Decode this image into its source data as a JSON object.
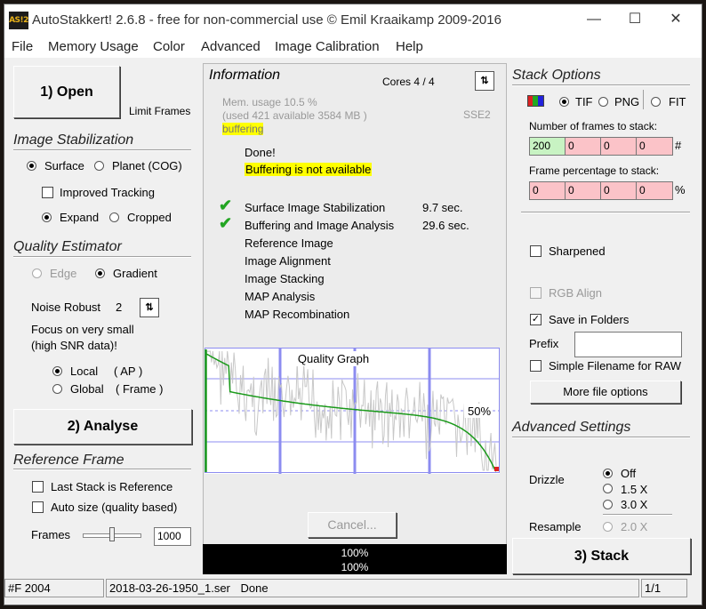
{
  "window": {
    "title": "AutoStakkert! 2.6.8 - free for non-commercial use © Emil Kraaikamp 2009-2016",
    "logo_text": "AS!2",
    "minimize_glyph": "—",
    "maximize_glyph": "☐",
    "close_glyph": "✕"
  },
  "menu": [
    "File",
    "Memory Usage",
    "Color",
    "Advanced",
    "Image Calibration",
    "Help"
  ],
  "left": {
    "open_button": "1) Open",
    "limit_frames": "Limit Frames",
    "stabilization": {
      "title": "Image Stabilization",
      "surface": "Surface",
      "planet": "Planet (COG)",
      "improved_tracking": "Improved Tracking",
      "expand": "Expand",
      "cropped": "Cropped"
    },
    "quality": {
      "title": "Quality Estimator",
      "edge": "Edge",
      "gradient": "Gradient",
      "noise_robust_label": "Noise Robust",
      "noise_robust_value": "2",
      "focus_line1": "Focus on very small",
      "focus_line2": "(high SNR data)!",
      "local": "Local",
      "local_ap": "( AP )",
      "global": "Global",
      "global_frame": "( Frame )"
    },
    "analyse_button": "2) Analyse",
    "reference": {
      "title": "Reference Frame",
      "last_stack": "Last Stack is Reference",
      "auto_size": "Auto size (quality based)",
      "frames_label": "Frames",
      "frames_value": "1000"
    }
  },
  "info": {
    "title": "Information",
    "cores": "Cores 4 / 4",
    "mem_usage": "Mem. usage 10.5 %",
    "mem_detail": "(used 421 available 3584 MB )",
    "buffering": "buffering",
    "sse": "SSE2",
    "done": "Done!",
    "buffer_warning": "Buffering is not available",
    "steps": [
      {
        "label": "Surface Image Stabilization",
        "time": "9.7 sec.",
        "done": true
      },
      {
        "label": "Buffering and Image Analysis",
        "time": "29.6 sec.",
        "done": true
      },
      {
        "label": "Reference Image",
        "time": "",
        "done": false
      },
      {
        "label": "Image Alignment",
        "time": "",
        "done": false
      },
      {
        "label": "Image Stacking",
        "time": "",
        "done": false
      },
      {
        "label": "MAP Analysis",
        "time": "",
        "done": false
      },
      {
        "label": "MAP Recombination",
        "time": "",
        "done": false
      }
    ],
    "check_glyph": "✔",
    "graph_title": "Quality Graph",
    "graph_percent": "50%",
    "cancel_button": "Cancel...",
    "progress_line1": "100%",
    "progress_line2": "100%",
    "progress": 1.0
  },
  "stack": {
    "title": "Stack Options",
    "tif": "TIF",
    "png": "PNG",
    "fit": "FIT",
    "frames_label": "Number of frames to stack:",
    "frames_values": [
      "200",
      "0",
      "0",
      "0"
    ],
    "frames_suffix": "#",
    "percent_label": "Frame percentage to stack:",
    "percent_values": [
      "0",
      "0",
      "0",
      "0"
    ],
    "percent_suffix": "%",
    "sharpened": "Sharpened",
    "rgb_align": "RGB Align",
    "save_in_folders": "Save in Folders",
    "prefix_label": "Prefix",
    "prefix_value": "",
    "simple_filename": "Simple Filename for RAW",
    "more_options": "More file options",
    "checked_glyph": "✓"
  },
  "advanced": {
    "title": "Advanced Settings",
    "drizzle_label": "Drizzle",
    "off": "Off",
    "x15": "1.5 X",
    "x30": "3.0 X",
    "resample_label": "Resample",
    "x20": "2.0 X"
  },
  "stack_button": "3) Stack",
  "status": {
    "frames": "#F 2004",
    "file": "2018-03-26-1950_1.ser",
    "state": "Done",
    "page": "1/1"
  },
  "colors": {
    "graph_line": "#1a9a1a",
    "graph_noise": "#c8c8c8",
    "graph_grid": "#8c8cf0",
    "highlight": "#ffff00"
  }
}
